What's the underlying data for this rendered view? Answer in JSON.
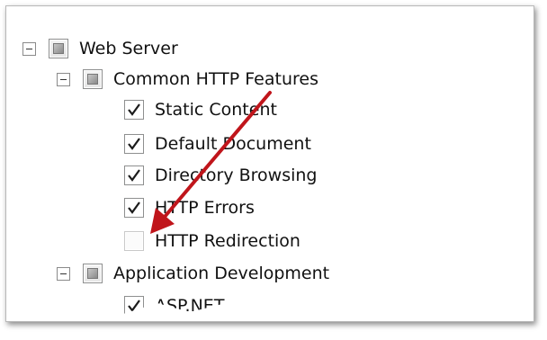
{
  "tree": {
    "web_server": {
      "label": "Web Server",
      "state": "partial"
    },
    "common_http": {
      "label": "Common HTTP Features",
      "state": "partial"
    },
    "static_content": {
      "label": "Static Content",
      "state": "checked"
    },
    "default_document": {
      "label": "Default Document",
      "state": "checked"
    },
    "directory_browsing": {
      "label": "Directory Browsing",
      "state": "checked"
    },
    "http_errors": {
      "label": "HTTP Errors",
      "state": "checked"
    },
    "http_redirection": {
      "label": "HTTP Redirection",
      "state": "unchecked"
    },
    "app_development": {
      "label": "Application Development",
      "state": "partial"
    },
    "asp_net": {
      "label": "ASP.NET",
      "state": "checked"
    }
  },
  "annotation": {
    "arrow_color": "#c0151b",
    "target": "http_redirection"
  }
}
